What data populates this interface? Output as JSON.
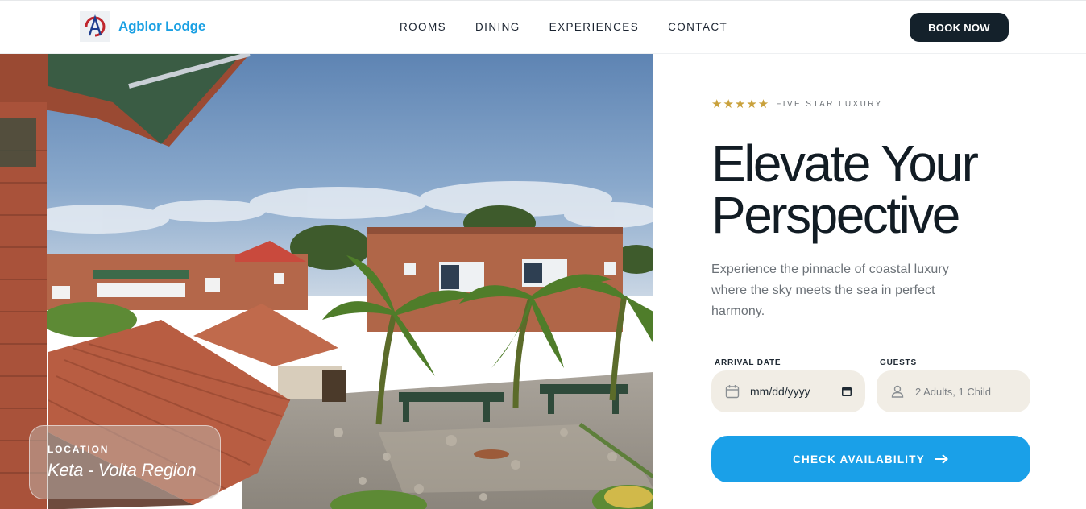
{
  "brand": {
    "name": "Agblor Lodge",
    "logo_icon": "lodge-logo-icon"
  },
  "nav": {
    "items": [
      {
        "label": "ROOMS"
      },
      {
        "label": "DINING"
      },
      {
        "label": "EXPERIENCES"
      },
      {
        "label": "CONTACT"
      }
    ],
    "cta_label": "BOOK NOW"
  },
  "hero": {
    "image_alt": "Rooftop view of lodge courtyard with palm trees and tiled roofs",
    "location": {
      "label": "LOCATION",
      "value": "Keta - Volta Region"
    }
  },
  "panel": {
    "rating": {
      "stars": "★★★★★",
      "text": "FIVE STAR LUXURY"
    },
    "headline_line1": "Elevate Your",
    "headline_line2": "Perspective",
    "subtext": "Experience the pinnacle of coastal luxury where the sky meets the sea in perfect harmony.",
    "form": {
      "arrival_label": "ARRIVAL DATE",
      "arrival_value": "mm/dd/yyyy",
      "guests_label": "GUESTS",
      "guests_placeholder": "2 Adults, 1 Child"
    },
    "cta_label": "CHECK AVAILABILITY"
  },
  "colors": {
    "accent": "#1aa0e8",
    "dark": "#14212b",
    "gold": "#c9a13c",
    "field_bg": "#f1ede5"
  }
}
